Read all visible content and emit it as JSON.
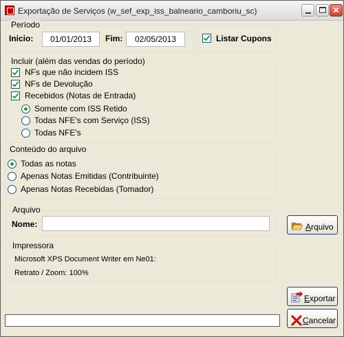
{
  "window": {
    "title": "Exportação de Serviços (w_sef_exp_iss_balneario_camboriu_sc)"
  },
  "periodo": {
    "group_label": "Período",
    "inicio_label": "Inicio:",
    "inicio_value": "01/01/2013",
    "fim_label": "Fim:",
    "fim_value": "02/05/2013",
    "listar_cupons_label": "Listar Cupons",
    "listar_cupons_checked": true
  },
  "incluir": {
    "group_label": "Incluir (além das vendas do período)",
    "nfs_nao_incidem_iss": "NFs que não incidem ISS",
    "nfs_devolucao": "NFs de Devolução",
    "recebidos": "Recebidos (Notas de Entrada)",
    "radio_iss_retido": "Somente com ISS Retido",
    "radio_nfe_servico": "Todas NFE's com Serviço (ISS)",
    "radio_todas_nfe": "Todas NFE's",
    "selected": "Somente com ISS Retido"
  },
  "conteudo": {
    "group_label": "Conteúdo do arquivo",
    "opt_todas": "Todas as notas",
    "opt_emitidas": "Apenas Notas Emitidas (Contribuinte)",
    "opt_recebidas": "Apenas Notas Recebidas (Tomador)",
    "selected": "Todas as notas"
  },
  "arquivo": {
    "group_label": "Arquivo",
    "nome_label": "Nome:",
    "nome_value": "",
    "button_label_underlined": "A",
    "button_label_rest": "rquivo"
  },
  "impressora": {
    "group_label": "Impressora",
    "printer": "Microsoft XPS Document Writer em Ne01:",
    "orientation": "Retrato / Zoom: 100%"
  },
  "buttons": {
    "exportar_underlined": "E",
    "exportar_rest": "xportar",
    "cancelar_underlined": "C",
    "cancelar_rest": "ancelar"
  },
  "colors": {
    "check_mark": "#21a121",
    "cancel_x": "#cc1010",
    "button_border": "#1e3d7a"
  }
}
